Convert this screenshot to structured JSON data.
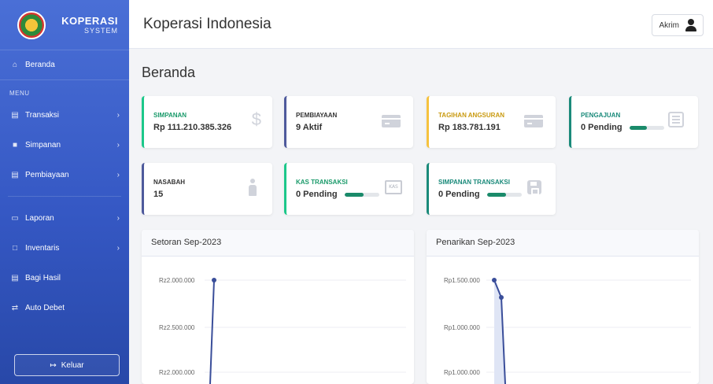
{
  "brand": {
    "title": "KOPERASI",
    "subtitle": "SYSTEM"
  },
  "sidebar": {
    "active": {
      "label": "Beranda",
      "icon": "home-icon"
    },
    "section_label": "MENU",
    "items": [
      {
        "label": "Transaksi",
        "icon": "money-icon",
        "has_submenu": true
      },
      {
        "label": "Simpanan",
        "icon": "lock-icon",
        "has_submenu": true
      },
      {
        "label": "Pembiayaan",
        "icon": "credit-card-icon",
        "has_submenu": true
      },
      {
        "label": "Laporan",
        "icon": "file-icon",
        "has_submenu": true
      },
      {
        "label": "Inventaris",
        "icon": "monitor-icon",
        "has_submenu": true
      },
      {
        "label": "Bagi Hasil",
        "icon": "money-icon",
        "has_submenu": false
      },
      {
        "label": "Auto Debet",
        "icon": "exchange-icon",
        "has_submenu": false
      }
    ],
    "logout_label": "Keluar"
  },
  "header": {
    "title": "Koperasi Indonesia",
    "user_name": "Akrim"
  },
  "page": {
    "title": "Beranda"
  },
  "cards": [
    {
      "label": "SIMPANAN",
      "value": "Rp 111.210.385.326",
      "icon": "dollar-icon",
      "accent": "#1cc88a"
    },
    {
      "label": "PEMBIAYAAN",
      "value": "9 Aktif",
      "icon": "credit-card-icon",
      "accent": "#4e5a9c"
    },
    {
      "label": "TAGIHAN ANGSURAN",
      "value": "Rp 183.781.191",
      "icon": "credit-card-icon",
      "accent": "#f6c23e"
    },
    {
      "label": "PENGAJUAN",
      "value": "0 Pending",
      "icon": "list-icon",
      "accent": "#1a8a7a",
      "progress": 0.5
    },
    {
      "label": "NASABAH",
      "value": "15",
      "icon": "person-icon",
      "accent": "#4e5a9c"
    },
    {
      "label": "KAS TRANSAKSI",
      "value": "0 Pending",
      "icon": "kas-icon",
      "accent": "#1cc88a",
      "progress": 0.55
    },
    {
      "label": "SIMPANAN TRANSAKSI",
      "value": "0 Pending",
      "icon": "save-icon",
      "accent": "#1a8a7a",
      "progress": 0.55
    }
  ],
  "charts": {
    "setoran": {
      "title": "Setoran Sep-2023",
      "yticks": [
        "Rz2.000.000",
        "Rz2.500.000",
        "Rz2.000.000"
      ]
    },
    "penarikan": {
      "title": "Penarikan Sep-2023",
      "yticks": [
        "Rp1.500.000",
        "Rp1.000.000",
        "Rp1.000.000"
      ]
    }
  },
  "chart_data": [
    {
      "type": "line",
      "title": "Setoran Sep-2023",
      "ytick_labels": [
        "Rz2.000.000",
        "Rz2.500.000",
        "Rz2.000.000"
      ],
      "series": [
        {
          "points": [
            [
              0,
              2000000
            ],
            [
              0,
              1600000
            ]
          ]
        }
      ]
    },
    {
      "type": "area",
      "title": "Penarikan Sep-2023",
      "ytick_labels": [
        "Rp1.500.000",
        "Rp1.000.000",
        "Rp1.000.000"
      ],
      "series": [
        {
          "points": [
            [
              0,
              1500000
            ],
            [
              0.1,
              1400000
            ],
            [
              0.3,
              950000
            ]
          ]
        }
      ]
    }
  ]
}
